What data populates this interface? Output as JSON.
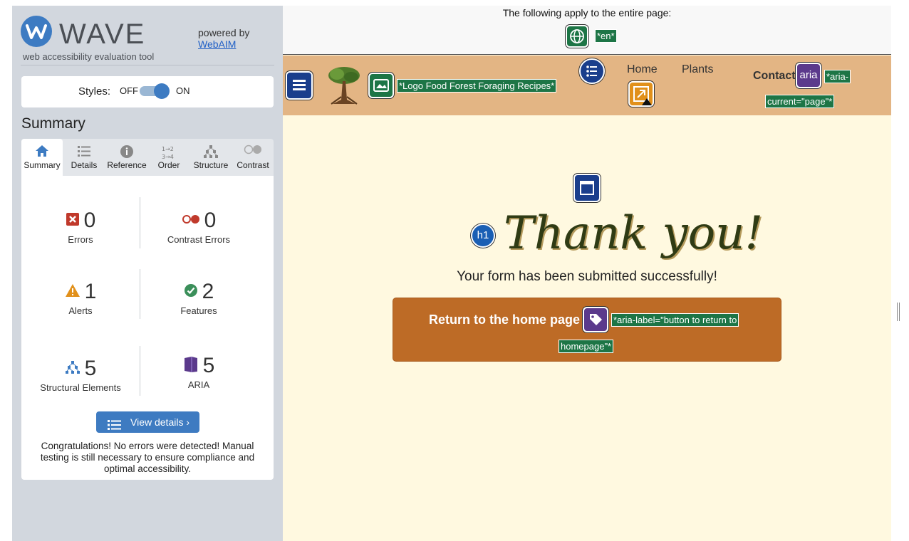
{
  "wave": {
    "logo_title": "WAVE",
    "logo_subtitle": "web accessibility evaluation tool",
    "powered_by": "powered by",
    "webaim_link": "WebAIM",
    "styles_label": "Styles:",
    "styles_off": "OFF",
    "styles_on": "ON",
    "summary_title": "Summary",
    "tabs": [
      {
        "label": "Summary",
        "icon": "home-icon"
      },
      {
        "label": "Details",
        "icon": "list-icon"
      },
      {
        "label": "Reference",
        "icon": "info-icon"
      },
      {
        "label": "Order",
        "icon": "order-icon"
      },
      {
        "label": "Structure",
        "icon": "structure-icon"
      },
      {
        "label": "Contrast",
        "icon": "contrast-icon"
      }
    ],
    "stats": {
      "errors": {
        "value": "0",
        "label": "Errors"
      },
      "contrast_errors": {
        "value": "0",
        "label": "Contrast Errors"
      },
      "alerts": {
        "value": "1",
        "label": "Alerts"
      },
      "features": {
        "value": "2",
        "label": "Features"
      },
      "structural": {
        "value": "5",
        "label": "Structural Elements"
      },
      "aria": {
        "value": "5",
        "label": "ARIA"
      }
    },
    "view_details": "View details ›",
    "congrats": "Congratulations! No errors were detected! Manual testing is still necessary to ensure compliance and optimal accessibility."
  },
  "preview": {
    "entire_page_note": "The following apply to the entire page:",
    "lang_annotation": "*en*",
    "logo_annotation": "*Logo Food Forest Foraging Recipes*",
    "nav": {
      "home": "Home",
      "plants": "Plants",
      "contact": "Contact",
      "aria_badge": "aria",
      "aria_current_line1": "*aria-",
      "aria_current_line2": "current=\"page\"*"
    },
    "h1_badge": "h1",
    "heading": "Thank you!",
    "submitted": "Your form has been submitted successfully!",
    "return_button": "Return to the home page",
    "aria_label_line1": "*aria-label=\"button to return to",
    "aria_label_line2": "homepage\"*"
  },
  "colors": {
    "wave_blue": "#3d7bc2",
    "annotation_green": "#1d7546",
    "header_tan": "#e3b584",
    "page_cream": "#fff9e0",
    "button_brown": "#bd6b26",
    "aria_purple": "#5b3a8c",
    "error_red": "#c0392b",
    "alert_orange": "#e1901b",
    "feature_green": "#3b8f5a"
  }
}
